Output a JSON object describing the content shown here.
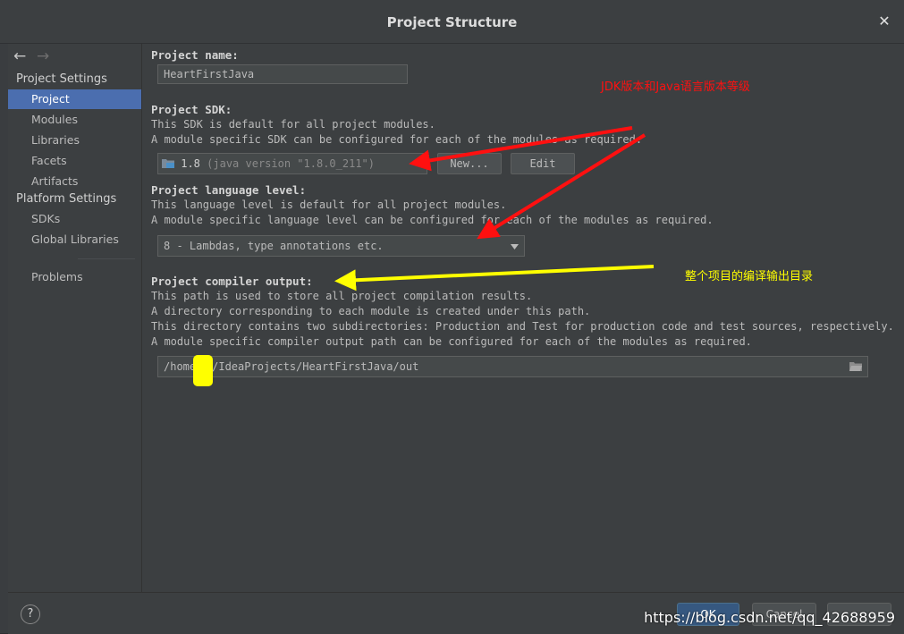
{
  "window": {
    "title": "Project Structure",
    "close_glyph": "✕"
  },
  "sidebar": {
    "back_glyph": "←",
    "forward_glyph": "→",
    "groups": [
      "Project Settings",
      "Platform Settings"
    ],
    "items": [
      "Project",
      "Modules",
      "Libraries",
      "Facets",
      "Artifacts",
      "SDKs",
      "Global Libraries",
      "Problems"
    ],
    "selected": "Project"
  },
  "main": {
    "project_name": {
      "label": "Project name:",
      "value": "HeartFirstJava"
    },
    "sdk": {
      "label": "Project SDK:",
      "desc1": "This SDK is default for all project modules.",
      "desc2": "A module specific SDK can be configured for each of the modules as required.",
      "value": "1.8",
      "version": "(java version \"1.8.0_211\")",
      "new_button": "New...",
      "edit_button": "Edit"
    },
    "language_level": {
      "label": "Project language level:",
      "desc1": "This language level is default for all project modules.",
      "desc2": "A module specific language level can be configured for each of the modules as required.",
      "value": "8 - Lambdas, type annotations etc."
    },
    "compiler_output": {
      "label": "Project compiler output:",
      "desc1": "This path is used to store all project compilation results.",
      "desc2": "A directory corresponding to each module is created under this path.",
      "desc3": "This directory contains two subdirectories: Production and Test for production code and test sources, respectively.",
      "desc4": "A module specific compiler output path can be configured for each of the modules as required.",
      "path_start": "/home",
      "path_end": "/IdeaProjects/HeartFirstJava/out"
    }
  },
  "footer": {
    "help": "?",
    "ok": "OK",
    "cancel": "Cancel",
    "apply": ""
  },
  "annotations": {
    "jdk_note": "JDK版本和Java语言版本等级",
    "output_note": "整个项目的编译输出目录",
    "watermark": "https://blog.csdn.net/qq_42688959",
    "red": "#ff1010",
    "yellow": "#ffff00"
  },
  "colors": {
    "selection": "#4b6eaf",
    "ok_button": "#365880"
  }
}
